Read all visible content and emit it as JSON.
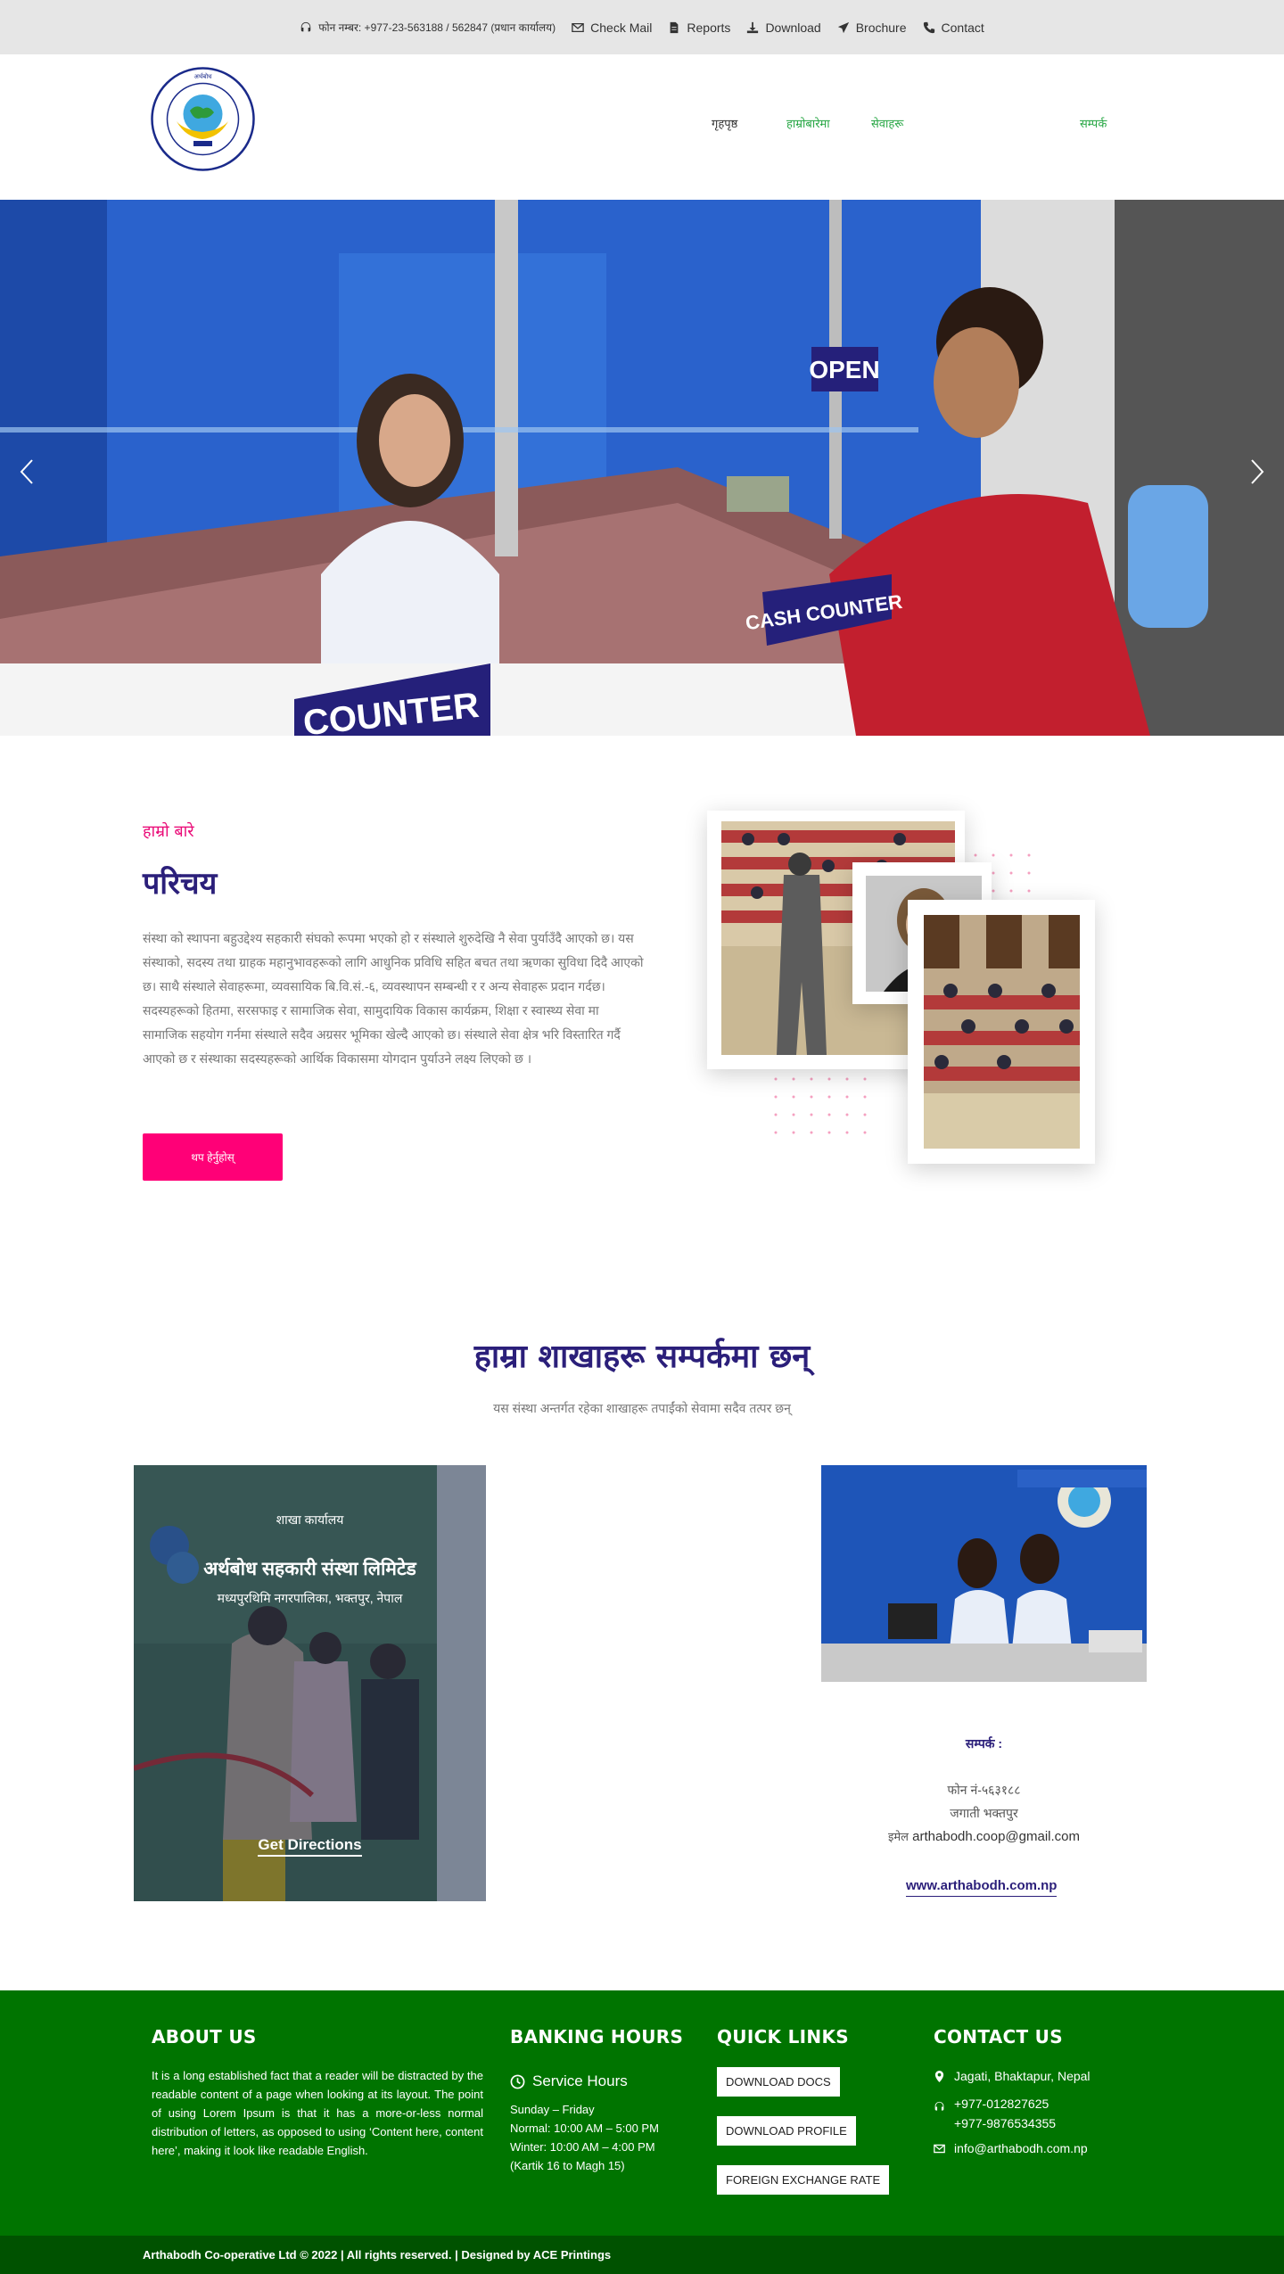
{
  "topbar": {
    "phone": "फोन नम्बर: +977-23-563188 / 562847 (प्रधान कार्यालय)",
    "check_mail": "Check Mail",
    "reports": "Reports",
    "download": "Download",
    "brochure": "Brochure",
    "contact": "Contact"
  },
  "header": {
    "logo_text": "अर्थबोध बहुउद्देश्यीय सहकारी संस्था लि",
    "nav": [
      "गृहपृष्ठ",
      "हाम्रोबारेमा",
      "सेवाहरू",
      "सम्पर्क"
    ]
  },
  "hero": {
    "sign_open": "OPEN",
    "sign_cash": "CASH COUNTER",
    "sign_counter": "COUNTER"
  },
  "about": {
    "kicker": "हाम्रो बारे",
    "title": "परिचय",
    "text": "संस्था को स्थापना बहुउद्देश्य सहकारी संघको रूपमा भएको हो र संस्थाले शुरुदेखि नै सेवा पुर्याउँदै आएको छ। यस संस्थाको, सदस्य तथा ग्राहक महानुभावहरूको लागि आधुनिक प्रविधि सहित बचत तथा ऋणका सुविधा दिदै आएको छ। साथै संस्थाले सेवाहरूमा, व्यवसायिक बि.वि.सं.-६, व्यवस्थापन सम्बन्धी र र अन्य सेवाहरू प्रदान गर्दछ। सदस्यहरूको हितमा, सरसफाइ र सामाजिक सेवा, सामुदायिक विकास कार्यक्रम, शिक्षा र स्वास्थ्य सेवा मा सामाजिक सहयोग गर्नमा संस्थाले सदैव अग्रसर भूमिका खेल्दै आएको छ। संस्थाले सेवा क्षेत्र भरि विस्तारित गर्दै आएको छ र संस्थाका सदस्यहरूको आर्थिक विकासमा योगदान पुर्याउने लक्ष्य लिएको छ ।",
    "button": "थप हेर्नुहोस्"
  },
  "branches": {
    "title": "हाम्रा शाखाहरू सम्पर्कमा छन्",
    "subtitle": "यस संस्था अन्तर्गत रहेका शाखाहरू तपाईंको सेवामा सदैव तत्पर छन्",
    "card_kicker": "शाखा कार्यालय",
    "card_title": "अर्थबोध सहकारी संस्था लिमिटेड",
    "card_address": "मध्यपुरथिमि नगरपालिका, भक्तपुर, नेपाल",
    "directions": "Get Directions",
    "contact_heading": "सम्पर्क :",
    "line1": "फोन नं-५६३१८८",
    "line2": "जगाती भक्तपुर",
    "email_label": "इमेल",
    "email": "arthabodh.coop@gmail.com",
    "website": "www.arthabodh.com.np"
  },
  "footer": {
    "about_h": "ABOUT US",
    "about_text": "It is a long established fact that a reader will be distracted by the readable content of a page when looking at its layout. The point of using Lorem Ipsum is that it has a more-or-less normal distribution of letters, as opposed to using ‘Content here, content here’, making it look like readable English.",
    "hours_h": "BANKING HOURS",
    "service_hours": "Service Hours",
    "hours": [
      "Sunday – Friday",
      "Normal: 10:00 AM – 5:00 PM",
      "Winter: 10:00 AM – 4:00 PM",
      "(Kartik 16 to Magh 15)"
    ],
    "links_h": "QUICK LINKS",
    "links": [
      "DOWNLOAD DOCS",
      "DOWNLOAD PROFILE",
      "FOREIGN EXCHANGE RATE"
    ],
    "contact_h": "CONTACT US",
    "address": "Jagati, Bhaktapur, Nepal",
    "phone1": "+977-012827625",
    "phone2": "+977-9876534355",
    "email": "info@arthabodh.com.np",
    "copyright": "Arthabodh Co-operative Ltd © 2022 | All rights reserved. | Designed by ACE Printings"
  },
  "colors": {
    "accent_pink": "#ff0077",
    "navy": "#2b1f7a",
    "footer_green": "#007400",
    "nav_green": "#28a745"
  }
}
